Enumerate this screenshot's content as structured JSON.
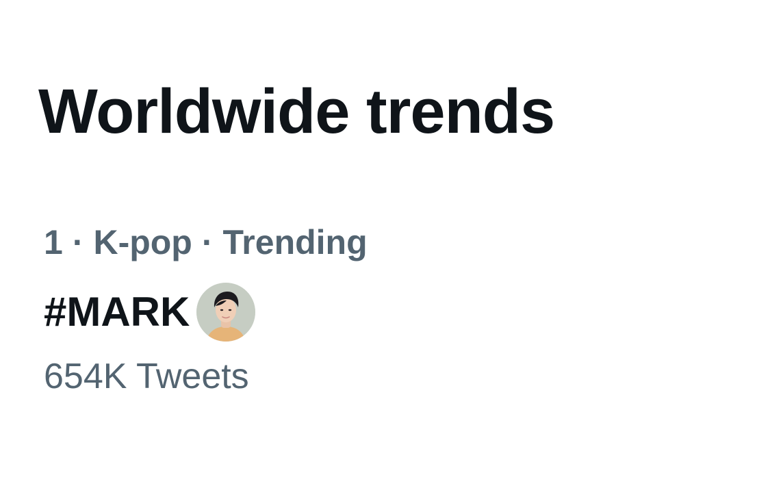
{
  "header": {
    "title": "Worldwide trends"
  },
  "trends": [
    {
      "rank": "1",
      "separator": "·",
      "category": "K-pop",
      "status": "Trending",
      "name": "#MARK",
      "hashflag_icon": "avatar-hashflag-icon",
      "count": "654K Tweets"
    }
  ],
  "colors": {
    "primary_text": "#0f1419",
    "secondary_text": "#536471",
    "background": "#ffffff"
  }
}
